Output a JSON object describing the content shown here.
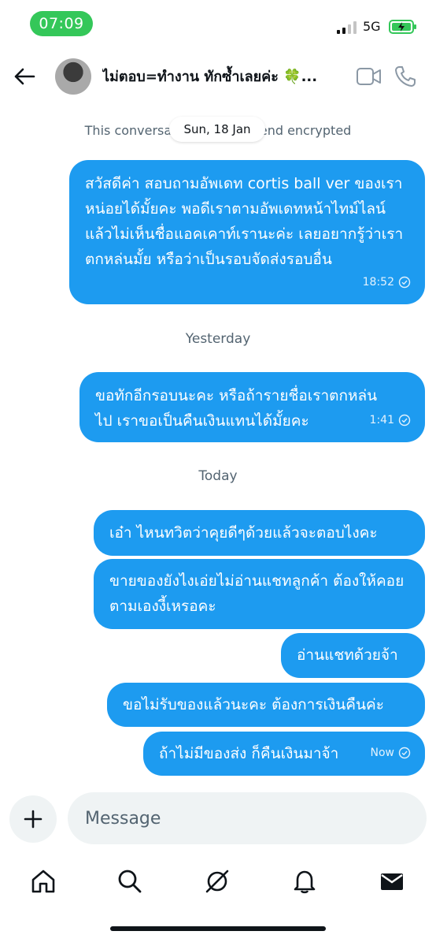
{
  "status_bar": {
    "time": "07:09",
    "network": "5G"
  },
  "header": {
    "title": "ไม่ตอบ=ทำงาน ทักซ้ำเลยค่ะ 🍀..."
  },
  "encryption_note": "This conversation is end-to-end encrypted",
  "date_chip": "Sun, 18 Jan",
  "day_separators": {
    "yesterday": "Yesterday",
    "today": "Today"
  },
  "messages": [
    {
      "text": "สวัสดีค่า สอบถามอัพเดท cortis ball ver ของเราหน่อยได้มั้ยคะ พอดีเราตามอัพเดทหน้าไทม์ไลน์แล้วไม่เห็นชื่อแอคเคาท์เรานะค่ะ เลยอยากรู้ว่าเราตกหล่นมั้ย หรือว่าเป็นรอบจัดส่งรอบอื่น",
      "time": "18:52"
    },
    {
      "text": "ขอทักอีกรอบนะคะ หรือถ้ารายชื่อเราตกหล่นไป เราขอเป็นคืนเงินแทนได้มั้ยคะ",
      "time": "1:41"
    },
    {
      "text": "เอ๋า ไหนทวิตว่าคุยดีๆด้วยแล้วจะตอบไงคะ"
    },
    {
      "text": "ขายของยังไงเอ่ยไม่อ่านแชทลูกค้า ต้องให้คอยตามเองงี้เหรอคะ"
    },
    {
      "text": "อ่านแชทด้วยจ้า"
    },
    {
      "text": "ขอไม่รับของแล้วนะคะ ต้องการเงินคืนค่ะ"
    },
    {
      "text": "ถ้าไม่มีของส่ง ก็คืนเงินมาจ้า",
      "time": "Now"
    }
  ],
  "composer": {
    "placeholder": "Message"
  },
  "icons": {
    "back": "arrow-left-icon",
    "video": "video-camera-icon",
    "phone": "phone-icon",
    "plus": "plus-icon",
    "home": "home-icon",
    "search": "search-icon",
    "grok": "grok-icon",
    "notifications": "bell-icon",
    "messages": "envelope-icon"
  },
  "colors": {
    "bubble": "#1d9bf0",
    "status_pill": "#34c759",
    "battery": "#34c759"
  }
}
